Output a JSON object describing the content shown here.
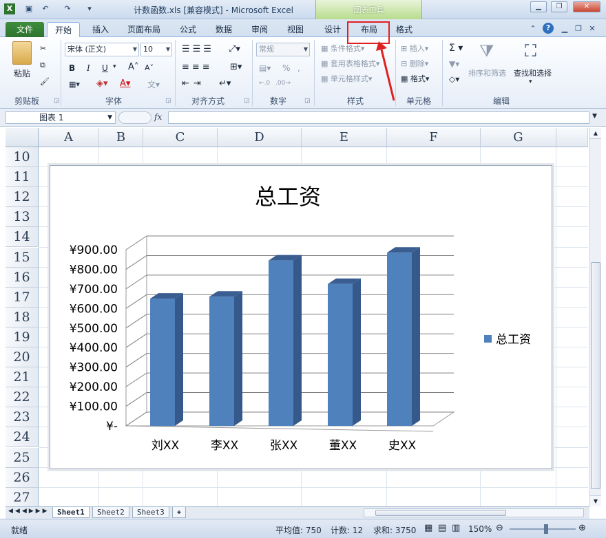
{
  "window": {
    "title": "计数函数.xls  [兼容模式]  -  Microsoft Excel",
    "context_tab_group": "图表工具"
  },
  "tabs": [
    {
      "label": "文件"
    },
    {
      "label": "开始"
    },
    {
      "label": "插入"
    },
    {
      "label": "页面布局"
    },
    {
      "label": "公式"
    },
    {
      "label": "数据"
    },
    {
      "label": "审阅"
    },
    {
      "label": "视图"
    },
    {
      "label": "设计"
    },
    {
      "label": "布局"
    },
    {
      "label": "格式"
    }
  ],
  "ribbon": {
    "clipboard": {
      "label": "剪贴板",
      "paste": "粘贴"
    },
    "font": {
      "label": "字体",
      "name": "宋体 (正文)",
      "size": "10",
      "bold": "B",
      "italic": "I",
      "underline": "U"
    },
    "alignment": {
      "label": "对齐方式"
    },
    "number": {
      "label": "数字",
      "format": "常规"
    },
    "styles": {
      "label": "样式",
      "conditional": "条件格式",
      "table_format": "套用表格格式",
      "cell_styles": "单元格样式"
    },
    "cells": {
      "label": "单元格",
      "insert": "插入",
      "delete": "删除",
      "format": "格式"
    },
    "editing": {
      "label": "编辑",
      "sort_filter": "排序和筛选",
      "find_select": "查找和选择"
    }
  },
  "formula_bar": {
    "name_box": "图表 1",
    "fx": "fx",
    "value": ""
  },
  "columns": [
    "A",
    "B",
    "C",
    "D",
    "E",
    "F",
    "G"
  ],
  "rows": [
    "10",
    "11",
    "12",
    "13",
    "14",
    "15",
    "16",
    "17",
    "18",
    "19",
    "20",
    "21",
    "22",
    "23",
    "24",
    "25",
    "26",
    "27"
  ],
  "chart_data": {
    "type": "bar",
    "title": "总工资",
    "categories": [
      "刘XX",
      "李XX",
      "张XX",
      "董XX",
      "史XX"
    ],
    "series": [
      {
        "name": "总工资",
        "values": [
          650,
          660,
          845,
          725,
          885
        ],
        "color": "#4f81bd"
      }
    ],
    "ylim": [
      0,
      900
    ],
    "yticks": [
      "¥-",
      "¥100.00",
      "¥200.00",
      "¥300.00",
      "¥400.00",
      "¥500.00",
      "¥600.00",
      "¥700.00",
      "¥800.00",
      "¥900.00"
    ],
    "legend": "right",
    "three_d": true
  },
  "sheets": [
    "Sheet1",
    "Sheet2",
    "Sheet3"
  ],
  "status": {
    "ready": "就绪",
    "average": "平均值: 750",
    "count": "计数: 12",
    "sum": "求和: 3750",
    "zoom": "150%"
  },
  "colors": {
    "file_tab": "#2e7430",
    "highlight": "#e02020",
    "bar": "#4f81bd"
  }
}
